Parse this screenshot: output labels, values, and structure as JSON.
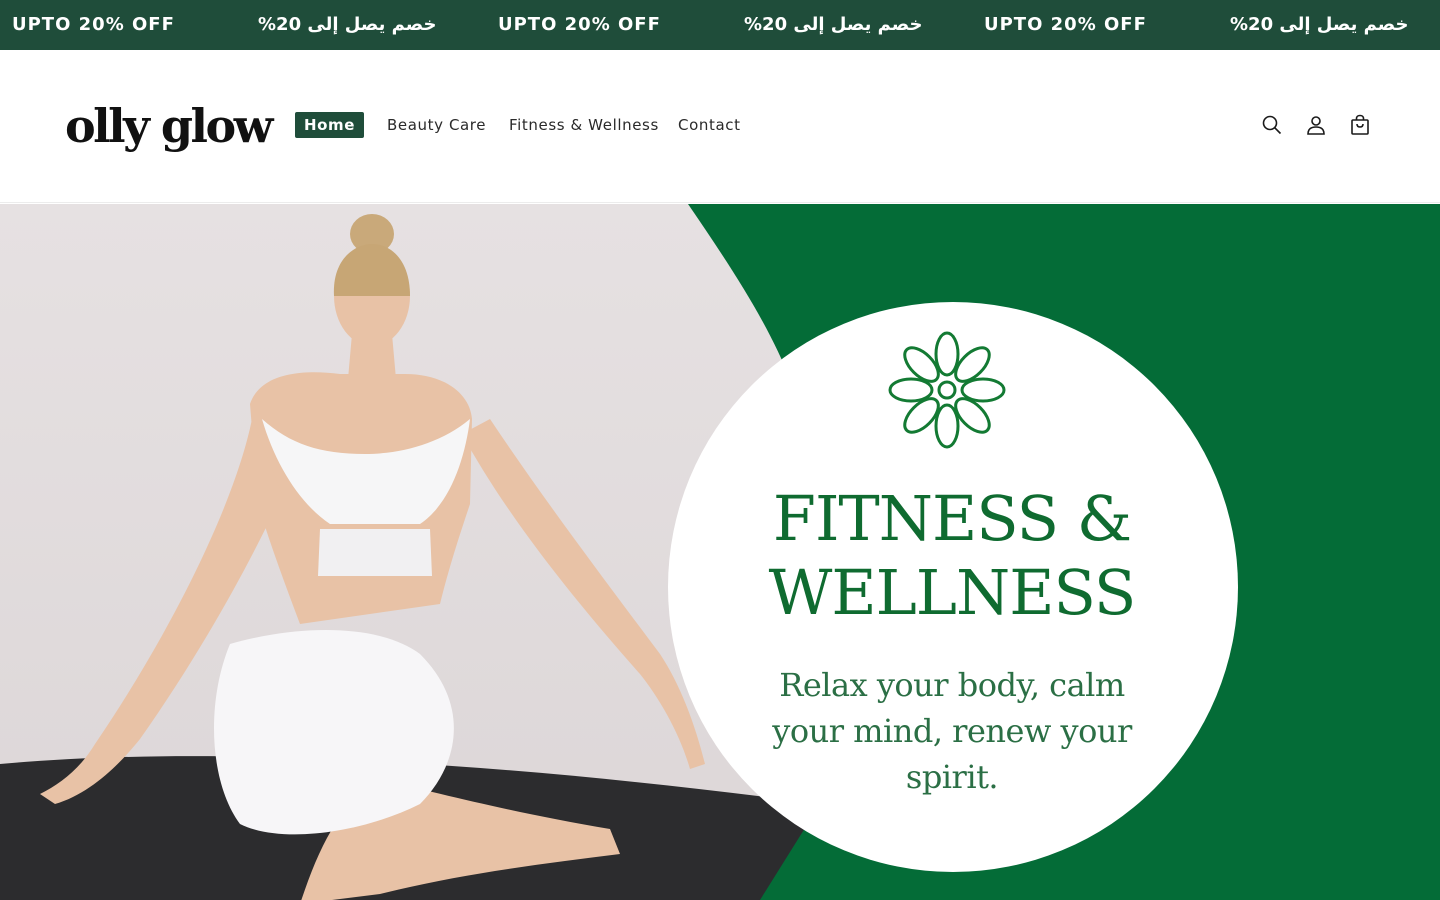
{
  "announcement": {
    "items": [
      {
        "text": "UPTO 20% OFF",
        "lang": "en"
      },
      {
        "text": "خصم يصل إلى 20%",
        "lang": "ar"
      },
      {
        "text": "UPTO 20% OFF",
        "lang": "en"
      },
      {
        "text": "خصم يصل إلى 20%",
        "lang": "ar"
      },
      {
        "text": "UPTO 20% OFF",
        "lang": "en"
      },
      {
        "text": "خصم يصل إلى 20%",
        "lang": "ar"
      }
    ]
  },
  "header": {
    "logo_text": "olly glow",
    "nav": [
      {
        "label": "Home",
        "active": true
      },
      {
        "label": "Beauty Care",
        "active": false
      },
      {
        "label": "Fitness & Wellness",
        "active": false
      },
      {
        "label": "Contact",
        "active": false
      }
    ],
    "icons": [
      "search-icon",
      "account-icon",
      "cart-icon"
    ]
  },
  "hero": {
    "title_line1": "FITNESS &",
    "title_line2": "WELLNESS",
    "subtitle": "Relax your body, calm your mind, renew your spirit."
  },
  "colors": {
    "announcement_bg": "#1f4d3a",
    "nav_active_bg": "#1f4d3a",
    "hero_green": "#046c37",
    "hero_text_green": "#0f6b30",
    "photo_bg": "#e4dfe0"
  }
}
